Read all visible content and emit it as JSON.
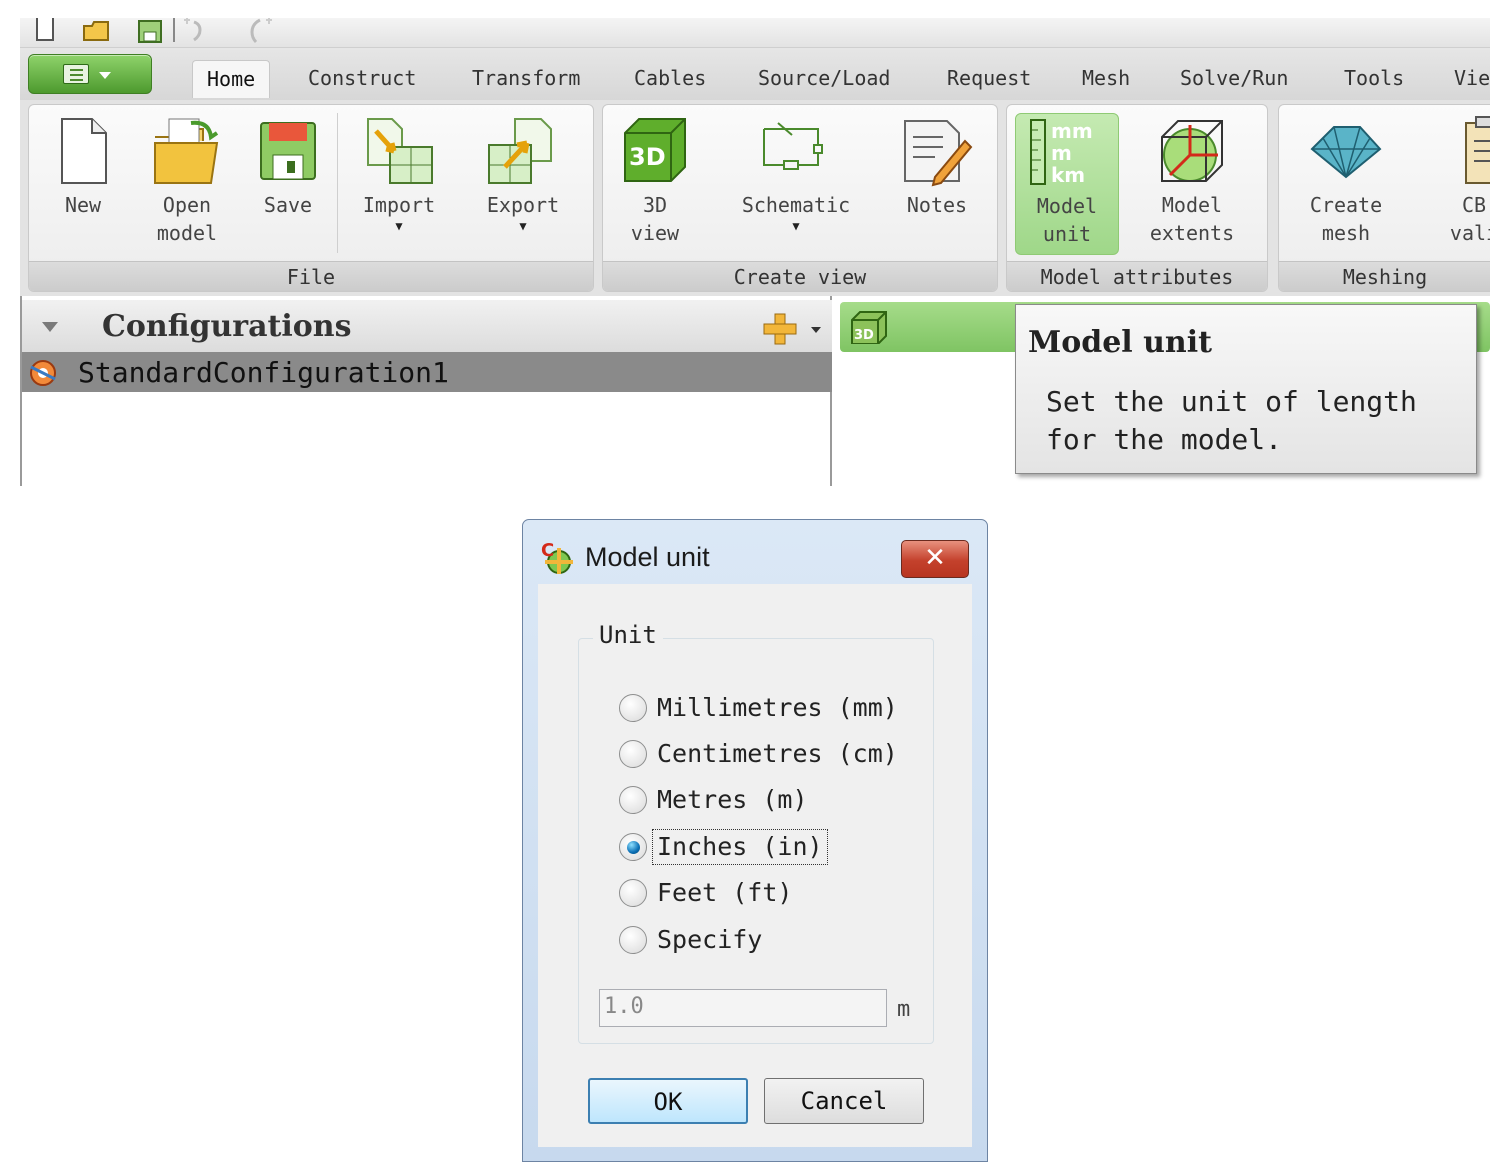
{
  "ribbon_tabs": [
    {
      "label": "Home",
      "active": true
    },
    {
      "label": "Construct"
    },
    {
      "label": "Transform"
    },
    {
      "label": "Cables"
    },
    {
      "label": "Source/Load"
    },
    {
      "label": "Request"
    },
    {
      "label": "Mesh"
    },
    {
      "label": "Solve/Run"
    },
    {
      "label": "Tools"
    },
    {
      "label": "Vie"
    }
  ],
  "groups": {
    "file": {
      "title": "File",
      "buttons": {
        "new": "New",
        "open": "Open\nmodel",
        "save": "Save",
        "import": "Import",
        "export": "Export"
      }
    },
    "create_view": {
      "title": "Create view",
      "buttons": {
        "view3d": "3D\nview",
        "schematic": "Schematic",
        "notes": "Notes"
      }
    },
    "model_attributes": {
      "title": "Model attributes",
      "buttons": {
        "model_unit": "Model\nunit",
        "model_extents": "Model\nextents"
      },
      "unit_icon_lines": [
        "mm",
        "m",
        "km"
      ]
    },
    "meshing": {
      "title": "Meshing",
      "buttons": {
        "create_mesh": "Create\nmesh",
        "cb_validate": "CB\nvali"
      }
    }
  },
  "configurations": {
    "title": "Configurations",
    "items": [
      "StandardConfiguration1"
    ]
  },
  "view_tab": {
    "icon_label": "3D"
  },
  "tooltip": {
    "title": "Model unit",
    "body": "Set the unit of length for the model."
  },
  "dialog": {
    "title": "Model unit",
    "close_label": "✕",
    "group_label": "Unit",
    "options": [
      {
        "label": "Millimetres (mm)",
        "checked": false
      },
      {
        "label": "Centimetres (cm)",
        "checked": false
      },
      {
        "label": "Metres (m)",
        "checked": false
      },
      {
        "label": "Inches (in)",
        "checked": true
      },
      {
        "label": "Feet (ft)",
        "checked": false
      },
      {
        "label": "Specify",
        "checked": false
      }
    ],
    "specify_value": "1.0",
    "specify_unit": "m",
    "ok_label": "OK",
    "cancel_label": "Cancel"
  },
  "colors": {
    "ribbon_green": "#8fd36b",
    "selected_green": "#a8db92",
    "dialog_frame": "#c7d9ee",
    "close_red": "#c4412c",
    "radio_checked": "#0a6fb5"
  }
}
